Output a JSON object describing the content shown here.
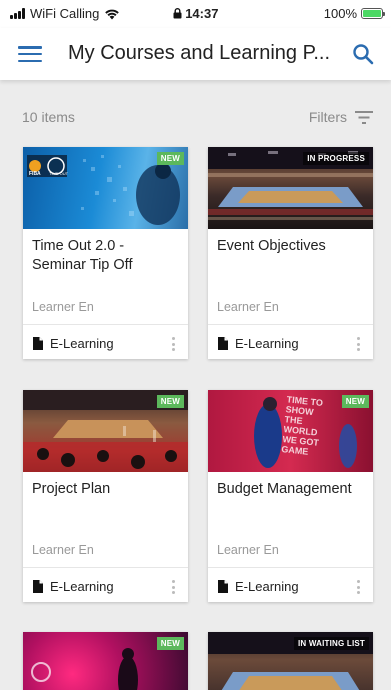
{
  "status_bar": {
    "carrier": "WiFi Calling",
    "time": "14:37",
    "battery": "100%"
  },
  "header": {
    "title": "My Courses and Learning P...",
    "menu_icon": "hamburger-menu-icon",
    "search_icon": "search-icon"
  },
  "toolbar": {
    "count": "10 items",
    "filters_label": "Filters"
  },
  "colors": {
    "accent": "#2b6cb0",
    "new_badge": "#5cb85c"
  },
  "cards": [
    {
      "title": "Time Out 2.0 - Seminar Tip Off",
      "badge": "NEW",
      "lang": "Learner En",
      "type": "E-Learning"
    },
    {
      "title": "Event Objectives",
      "badge": "IN PROGRESS",
      "lang": "Learner En",
      "type": "E-Learning"
    },
    {
      "title": "Project Plan",
      "badge": "NEW",
      "lang": "Learner En",
      "type": "E-Learning"
    },
    {
      "title": "Budget Management",
      "badge": "NEW",
      "lang": "Learner En",
      "type": "E-Learning"
    },
    {
      "badge": "NEW"
    },
    {
      "badge": "IN WAITING LIST"
    }
  ],
  "thumb_text": {
    "fiba": "FIBA",
    "timeout": "TIME OUT",
    "poster": [
      "TIME TO",
      "SHOW",
      "THE",
      "WORLD",
      "WE GOT",
      "GAME"
    ]
  }
}
